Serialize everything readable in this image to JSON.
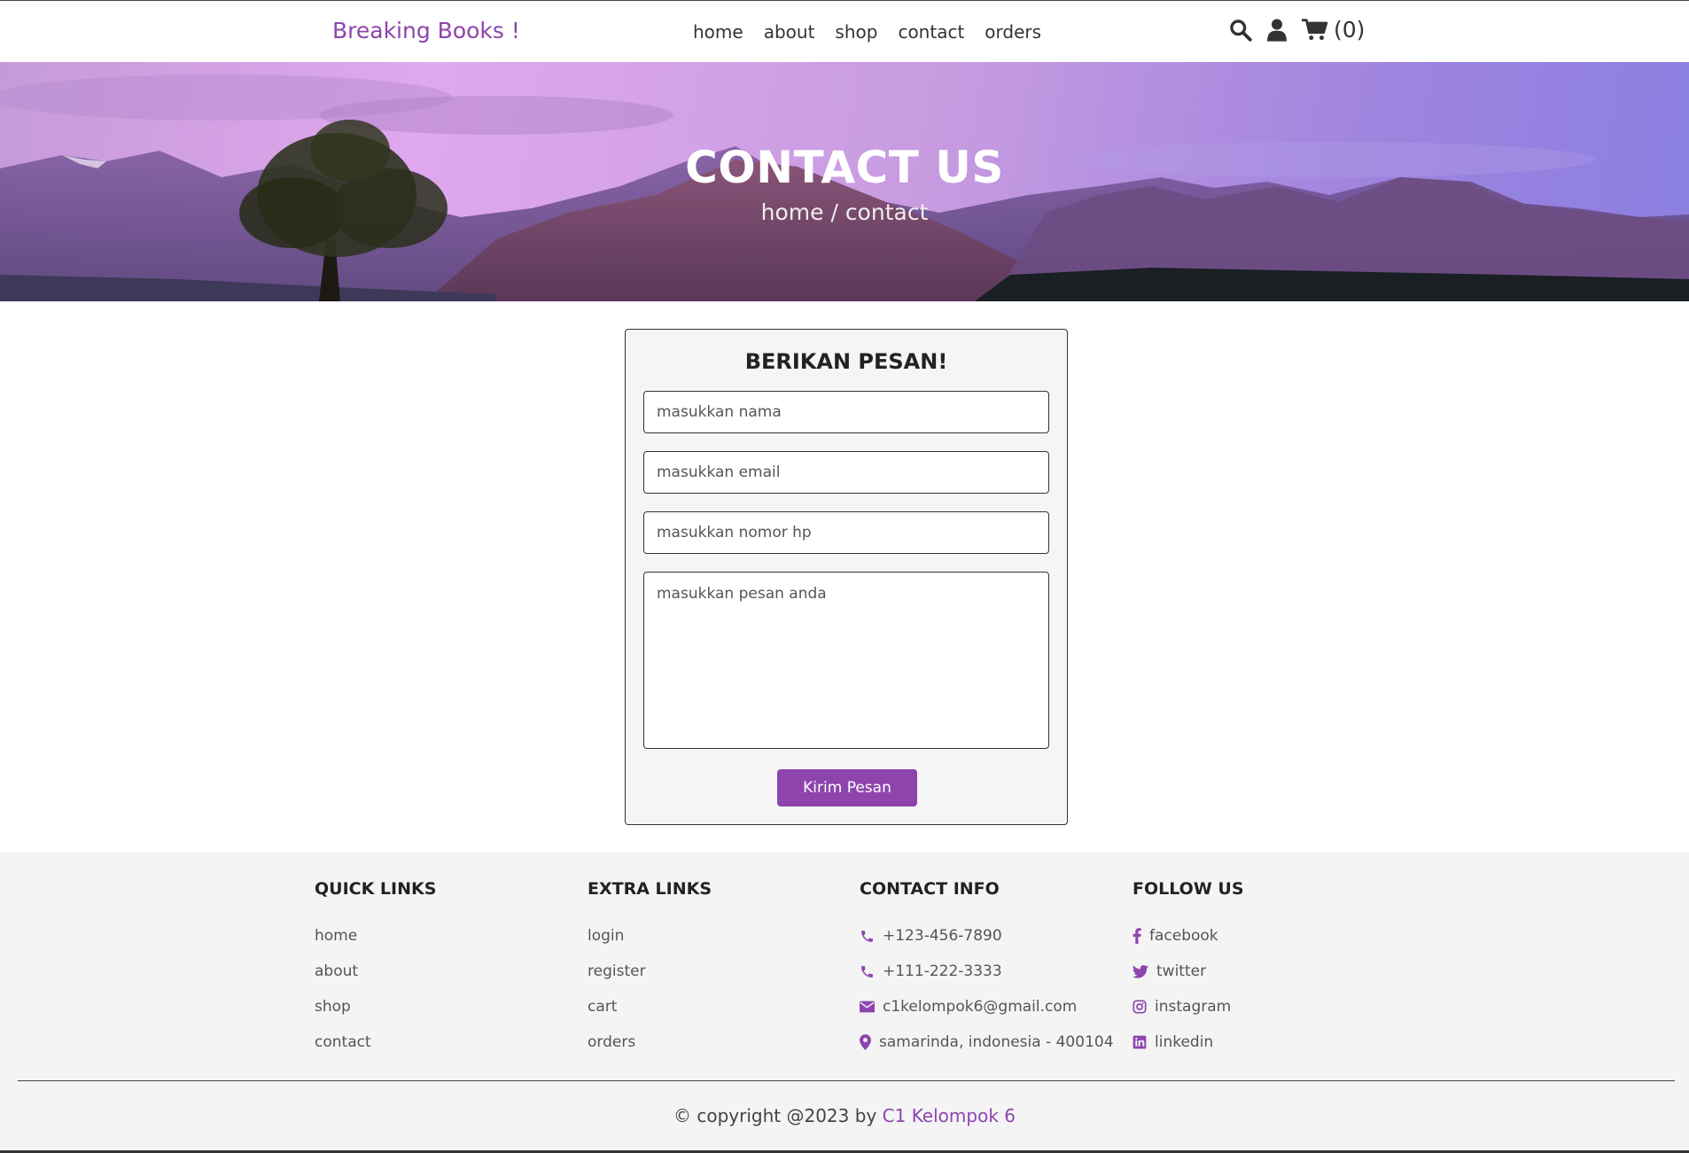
{
  "header": {
    "logo": "Breaking Books !",
    "nav": [
      "home",
      "about",
      "shop",
      "contact",
      "orders"
    ],
    "cart_count": "(0)"
  },
  "hero": {
    "title": "CONTACT US",
    "breadcrumb": "home / contact"
  },
  "form": {
    "title": "BERIKAN PESAN!",
    "name_placeholder": "masukkan nama",
    "email_placeholder": "masukkan email",
    "phone_placeholder": "masukkan nomor hp",
    "message_placeholder": "masukkan pesan anda",
    "submit_label": "Kirim Pesan"
  },
  "footer": {
    "quick_links": {
      "title": "QUICK LINKS",
      "items": [
        "home",
        "about",
        "shop",
        "contact"
      ]
    },
    "extra_links": {
      "title": "EXTRA LINKS",
      "items": [
        "login",
        "register",
        "cart",
        "orders"
      ]
    },
    "contact_info": {
      "title": "CONTACT INFO",
      "items": [
        "+123-456-7890",
        "+111-222-3333",
        "c1kelompok6@gmail.com",
        "samarinda, indonesia - 400104"
      ]
    },
    "follow_us": {
      "title": "FOLLOW US",
      "items": [
        "facebook",
        "twitter",
        "instagram",
        "linkedin"
      ]
    },
    "copyright_prefix": "© copyright @2023 by",
    "copyright_name": "C1 Kelompok 6"
  },
  "colors": {
    "accent": "#8e44ad",
    "footer_bg": "#f4f4f4",
    "form_bg": "#f5f5f5"
  },
  "icons": [
    "search-icon",
    "user-icon",
    "cart-icon",
    "phone-icon",
    "envelope-icon",
    "map-pin-icon",
    "facebook-icon",
    "twitter-icon",
    "instagram-icon",
    "linkedin-icon"
  ]
}
